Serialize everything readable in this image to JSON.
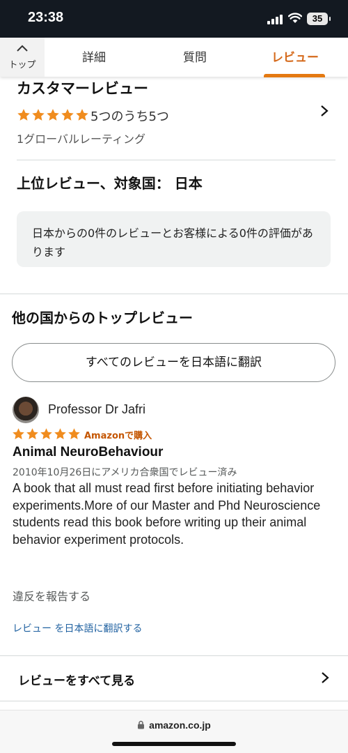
{
  "status_bar": {
    "time": "23:38",
    "battery": "35"
  },
  "nav": {
    "top_label": "トップ",
    "tabs": [
      {
        "label": "詳細",
        "active": false
      },
      {
        "label": "質問",
        "active": false
      },
      {
        "label": "レビュー",
        "active": true
      }
    ]
  },
  "summary": {
    "title": "カスタマーレビュー",
    "rating": 5,
    "rating_text": "5つのうち5つ",
    "global_count": "1グローバルレーティング"
  },
  "top_reviews": {
    "title": "上位レビュー、対象国： 日本",
    "notice": "日本からの0件のレビューとお客様による0件の評価があります"
  },
  "other_countries": {
    "title": "他の国からのトップレビュー",
    "translate_all_label": "すべてのレビューを日本語に翻訳"
  },
  "review": {
    "reviewer": "Professor Dr Jafri",
    "rating": 5,
    "verified": "Amazonで購入",
    "title": "Animal NeuroBehaviour",
    "date": "2010年10月26日にアメリカ合衆国でレビュー済み",
    "body": "A book that all must read first before initiating behavior experiments.More of our Master and Phd Neuroscience students read this book before writing up their animal behavior experiment protocols.",
    "report_label": "違反を報告する",
    "translate_label": "レビュー を日本語に翻訳する"
  },
  "see_all_label": "レビューをすべて見る",
  "browser": {
    "url": "amazon.co.jp"
  },
  "colors": {
    "accent": "#e47911",
    "star": "#f08c1e",
    "link": "#2162a1",
    "status_bar": "#131921"
  }
}
